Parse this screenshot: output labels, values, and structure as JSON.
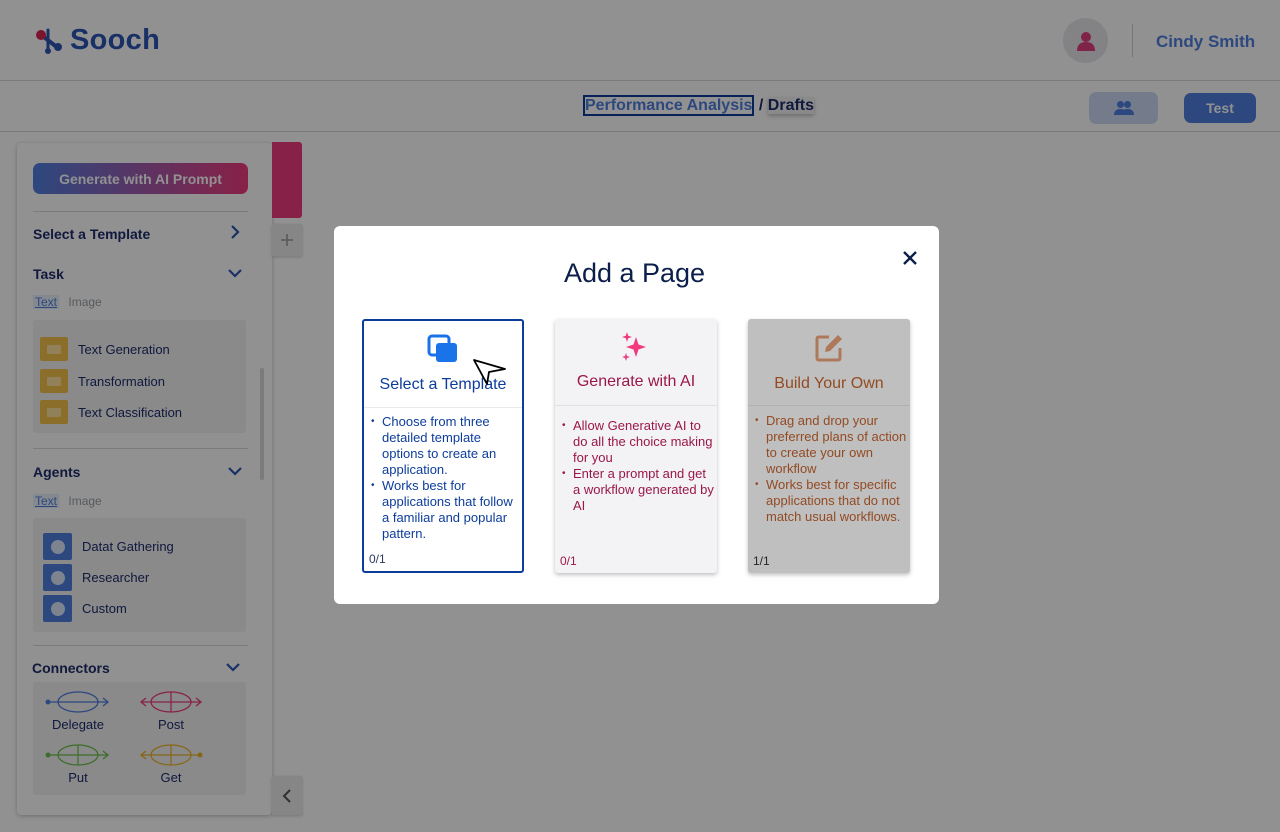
{
  "app": {
    "name": "Sooch",
    "user_name": "Cindy Smith"
  },
  "breadcrumb": {
    "project": "Performance Analysis",
    "separator": "/",
    "page": "Drafts"
  },
  "topbar": {
    "test_label": "Test"
  },
  "sidebar": {
    "generate_label": "Generate with AI Prompt",
    "select_template_label": "Select a Template",
    "task": {
      "heading": "Task",
      "tab_text": "Text",
      "tab_image": "Image",
      "items": [
        "Text Generation",
        "Transformation",
        "Text Classification"
      ]
    },
    "agents": {
      "heading": "Agents",
      "tab_text": "Text",
      "tab_image": "Image",
      "items": [
        "Datat Gathering",
        "Researcher",
        "Custom"
      ]
    },
    "connectors": {
      "heading": "Connectors",
      "items": [
        {
          "label": "Delegate",
          "color": "#4f7fe0"
        },
        {
          "label": "Post",
          "color": "#f03a7d"
        },
        {
          "label": "Put",
          "color": "#6cc04a"
        },
        {
          "label": "Get",
          "color": "#f0b429"
        }
      ]
    }
  },
  "modal": {
    "title": "Add a Page",
    "cards": [
      {
        "title": "Select a Template",
        "icon": "copy-icon",
        "color": "#0d3d9b",
        "bullets": [
          "Choose from three detailed template options to create an application.",
          "Works best for applications that follow a familiar and popular pattern."
        ],
        "count": "0/1"
      },
      {
        "title": "Generate with AI",
        "icon": "sparkles-icon",
        "color": "#f03a7d",
        "bullets": [
          "Allow Generative AI to do all the choice making for you",
          "Enter a prompt and get a workflow generated by AI"
        ],
        "count": "0/1"
      },
      {
        "title": "Build Your Own",
        "icon": "edit-icon",
        "color": "#c5642f",
        "bullets": [
          "Drag and drop your preferred plans of action to create your own workflow",
          "Works best for specific applications that do not match usual workflows."
        ],
        "count": "1/1"
      }
    ]
  }
}
